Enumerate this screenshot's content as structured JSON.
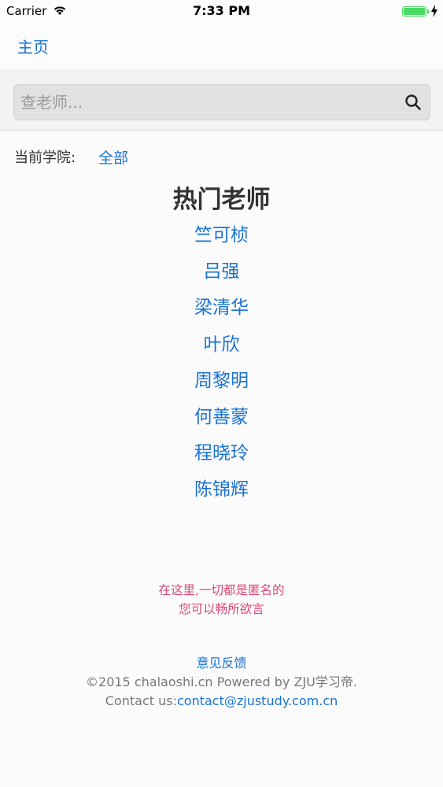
{
  "status_bar": {
    "carrier": "Carrier",
    "time": "7:33 PM",
    "battery_percent": 100
  },
  "nav": {
    "home_label": "主页"
  },
  "search": {
    "placeholder": "查老师..."
  },
  "college": {
    "label": "当前学院:",
    "value": "全部"
  },
  "hot_teachers": {
    "title": "热门老师",
    "items": [
      "竺可桢",
      "吕强",
      "梁清华",
      "叶欣",
      "周黎明",
      "何善蒙",
      "程晓玲",
      "陈锦辉"
    ]
  },
  "anonymous": {
    "line1": "在这里,一切都是匿名的",
    "line2": "您可以畅所欲言"
  },
  "footer": {
    "feedback": "意见反馈",
    "copyright": "©2015 chalaoshi.cn Powered by ZJU学习帝.",
    "contact_label": "Contact us:",
    "contact_email": "contact@zjustudy.com.cn"
  },
  "colors": {
    "link": "#1a73d1",
    "accent_pink": "#d94879",
    "battery": "#4cd964"
  }
}
